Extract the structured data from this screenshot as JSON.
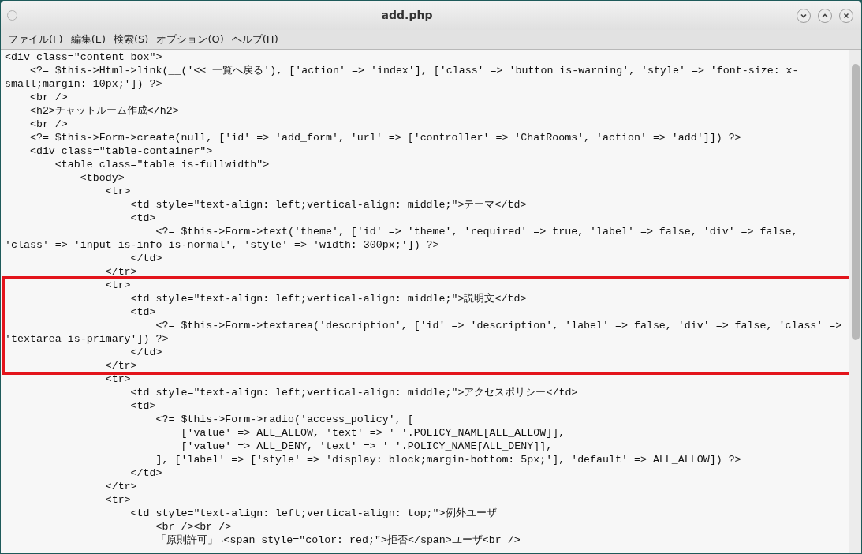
{
  "window": {
    "title": "add.php"
  },
  "menu": [
    {
      "label": "ファイル(F)"
    },
    {
      "label": "編集(E)"
    },
    {
      "label": "検索(S)"
    },
    {
      "label": "オプション(O)"
    },
    {
      "label": "ヘルプ(H)"
    }
  ],
  "editor": {
    "blocks": [
      {
        "highlighted": false,
        "lines": [
          "<div class=\"content box\">",
          "    <?= $this->Html->link(__('<< 一覧へ戻る'), ['action' => 'index'], ['class' => 'button is-warning', 'style' => 'font-size: x-",
          "small;margin: 10px;']) ?>",
          "    <br />",
          "    <h2>チャットルーム作成</h2>",
          "    <br />",
          "    <?= $this->Form->create(null, ['id' => 'add_form', 'url' => ['controller' => 'ChatRooms', 'action' => 'add']]) ?>",
          "    <div class=\"table-container\">",
          "        <table class=\"table is-fullwidth\">",
          "            <tbody>",
          "                <tr>",
          "                    <td style=\"text-align: left;vertical-align: middle;\">テーマ</td>",
          "                    <td>",
          "                        <?= $this->Form->text('theme', ['id' => 'theme', 'required' => true, 'label' => false, 'div' => false,",
          "'class' => 'input is-info is-normal', 'style' => 'width: 300px;']) ?>",
          "                    </td>",
          "                </tr>"
        ]
      },
      {
        "highlighted": true,
        "lines": [
          "                <tr>",
          "                    <td style=\"text-align: left;vertical-align: middle;\">説明文</td>",
          "                    <td>",
          "                        <?= $this->Form->textarea('description', ['id' => 'description', 'label' => false, 'div' => false, 'class' =>",
          "'textarea is-primary']) ?>",
          "                    </td>",
          "                </tr>"
        ]
      },
      {
        "highlighted": false,
        "lines": [
          "                <tr>",
          "                    <td style=\"text-align: left;vertical-align: middle;\">アクセスポリシー</td>",
          "                    <td>",
          "                        <?= $this->Form->radio('access_policy', [",
          "                            ['value' => ALL_ALLOW, 'text' => ' '.POLICY_NAME[ALL_ALLOW]],",
          "                            ['value' => ALL_DENY, 'text' => ' '.POLICY_NAME[ALL_DENY]],",
          "                        ], ['label' => ['style' => 'display: block;margin-bottom: 5px;'], 'default' => ALL_ALLOW]) ?>",
          "                    </td>",
          "                </tr>",
          "                <tr>",
          "                    <td style=\"text-align: left;vertical-align: top;\">例外ユーザ",
          "                        <br /><br />",
          "                        「原則許可」→<span style=\"color: red;\">拒否</span>ユーザ<br />"
        ]
      }
    ]
  }
}
